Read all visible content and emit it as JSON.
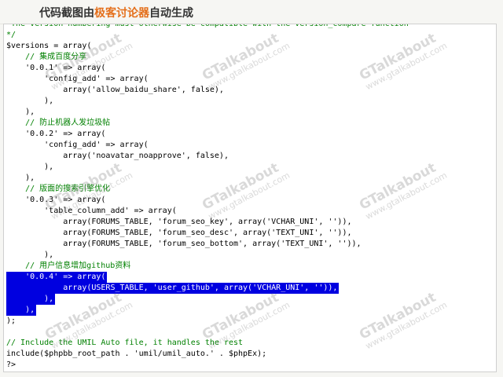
{
  "banner": {
    "prefix": "代码截图由",
    "highlight": "极客讨论器",
    "suffix": "自动生成"
  },
  "code_lines": [
    {
      "text": " The version numbering must otherwise be compatible with the version_compare function",
      "kind": "comment",
      "selected": false
    },
    {
      "text": "*/",
      "kind": "comment",
      "selected": false
    },
    {
      "text": "$versions = array(",
      "kind": "code",
      "selected": false
    },
    {
      "text": "    // 集成百度分享",
      "kind": "comment",
      "selected": false
    },
    {
      "text": "    '0.0.1' => array(",
      "kind": "code",
      "selected": false
    },
    {
      "text": "        'config_add' => array(",
      "kind": "code",
      "selected": false
    },
    {
      "text": "            array('allow_baidu_share', false),",
      "kind": "code",
      "selected": false
    },
    {
      "text": "        ),",
      "kind": "code",
      "selected": false
    },
    {
      "text": "    ),",
      "kind": "code",
      "selected": false
    },
    {
      "text": "    // 防止机器人发垃圾帖",
      "kind": "comment",
      "selected": false
    },
    {
      "text": "    '0.0.2' => array(",
      "kind": "code",
      "selected": false
    },
    {
      "text": "        'config_add' => array(",
      "kind": "code",
      "selected": false
    },
    {
      "text": "            array('noavatar_noapprove', false),",
      "kind": "code",
      "selected": false
    },
    {
      "text": "        ),",
      "kind": "code",
      "selected": false
    },
    {
      "text": "    ),",
      "kind": "code",
      "selected": false
    },
    {
      "text": "    // 版面的搜索引擎优化",
      "kind": "comment",
      "selected": false
    },
    {
      "text": "    '0.0.3' => array(",
      "kind": "code",
      "selected": false
    },
    {
      "text": "        'table_column_add' => array(",
      "kind": "code",
      "selected": false
    },
    {
      "text": "            array(FORUMS_TABLE, 'forum_seo_key', array('VCHAR_UNI', '')),",
      "kind": "code",
      "selected": false
    },
    {
      "text": "            array(FORUMS_TABLE, 'forum_seo_desc', array('TEXT_UNI', '')),",
      "kind": "code",
      "selected": false
    },
    {
      "text": "            array(FORUMS_TABLE, 'forum_seo_bottom', array('TEXT_UNI', '')),",
      "kind": "code",
      "selected": false
    },
    {
      "text": "        ),",
      "kind": "code",
      "selected": false
    },
    {
      "text": "    // 用户信息增加github资料",
      "kind": "comment",
      "selected": false
    },
    {
      "text": "    '0.0.4' => array(",
      "kind": "code",
      "selected": true
    },
    {
      "text": "            array(USERS_TABLE, 'user_github', array('VCHAR_UNI', '')),",
      "kind": "code",
      "selected": true
    },
    {
      "text": "        ),",
      "kind": "code",
      "selected": true
    },
    {
      "text": "    ),",
      "kind": "code",
      "selected": true
    },
    {
      "text": ");",
      "kind": "code",
      "selected": false
    },
    {
      "text": "",
      "kind": "code",
      "selected": false
    },
    {
      "text": "// Include the UMIL Auto file, it handles the rest",
      "kind": "comment",
      "selected": false
    },
    {
      "text": "include($phpbb_root_path . 'umil/umil_auto.' . $phpEx);",
      "kind": "code",
      "selected": false
    },
    {
      "text": "?>",
      "kind": "code",
      "selected": false
    }
  ],
  "watermark": {
    "brand": "GTalkabout",
    "url": "www.gtalkabout.com"
  },
  "colors": {
    "comment": "#008000",
    "selection": "#0000e0",
    "banner_highlight": "#e46f1b"
  }
}
